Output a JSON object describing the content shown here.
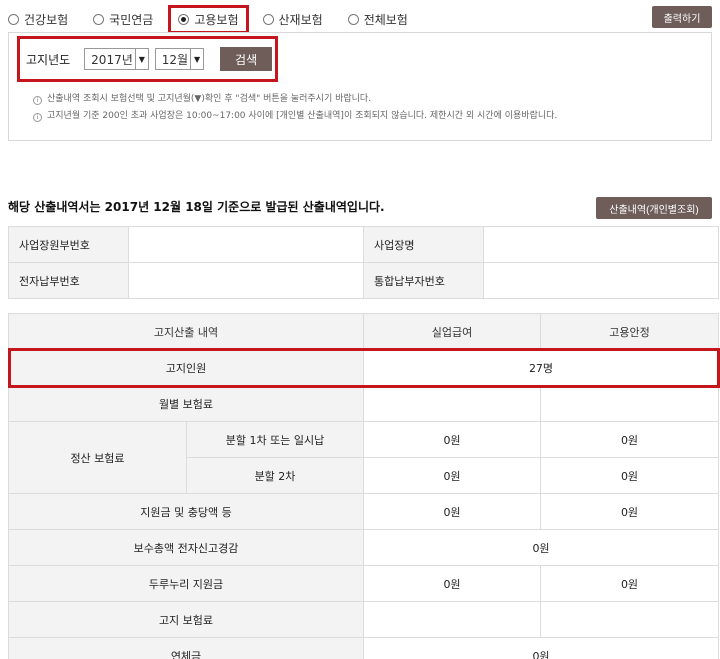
{
  "radios": [
    {
      "label": "건강보험",
      "selected": false
    },
    {
      "label": "국민연금",
      "selected": false
    },
    {
      "label": "고용보험",
      "selected": true
    },
    {
      "label": "산재보험",
      "selected": false
    },
    {
      "label": "전체보험",
      "selected": false
    }
  ],
  "print_button": "출력하기",
  "search": {
    "year_label": "고지년도",
    "year_value": "2017년",
    "month_value": "12월",
    "search_button": "검색"
  },
  "notes": [
    "산출내역 조회시 보험선택 및 고지년월(▼)확인 후 \"검색\" 버튼을 눌러주시기 바랍니다.",
    "고지년월 기준 200인 초과 사업장은 10:00~17:00 사이에 [개인별 산출내역]이 조회되지 않습니다. 제한시간 외 시간에 이용바랍니다."
  ],
  "notice": "해당 산출내역서는 2017년 12월 18일 기준으로 발급된 산출내역입니다.",
  "indiv_button": "산출내역(개인별조회)",
  "info": {
    "biz_no_label": "사업장원부번호",
    "biz_name_label": "사업장명",
    "elec_no_label": "전자납부번호",
    "combined_no_label": "통합납부자번호"
  },
  "calc": {
    "header": {
      "item": "고지산출 내역",
      "col1": "실업급여",
      "col2": "고용안정"
    },
    "notice_count": {
      "label": "고지인원",
      "value": "27명"
    },
    "monthly": {
      "label": "월별 보험료",
      "col1": "",
      "col2": ""
    },
    "settle": {
      "label": "정산 보험료",
      "sub1": {
        "label": "분할 1차 또는 일시납",
        "col1": "0원",
        "col2": "0원"
      },
      "sub2": {
        "label": "분할 2차",
        "col1": "0원",
        "col2": "0원"
      }
    },
    "support": {
      "label": "지원금 및 충당액 등",
      "col1": "0원",
      "col2": "0원"
    },
    "wage_reduction": {
      "label": "보수총액 전자신고경감",
      "value": "0원"
    },
    "durunuri": {
      "label": "두루누리 지원금",
      "col1": "0원",
      "col2": "0원"
    },
    "notice_premium": {
      "label": "고지 보험료",
      "col1": "",
      "col2": ""
    },
    "arrears": {
      "label": "연체금",
      "value": "0원"
    }
  }
}
